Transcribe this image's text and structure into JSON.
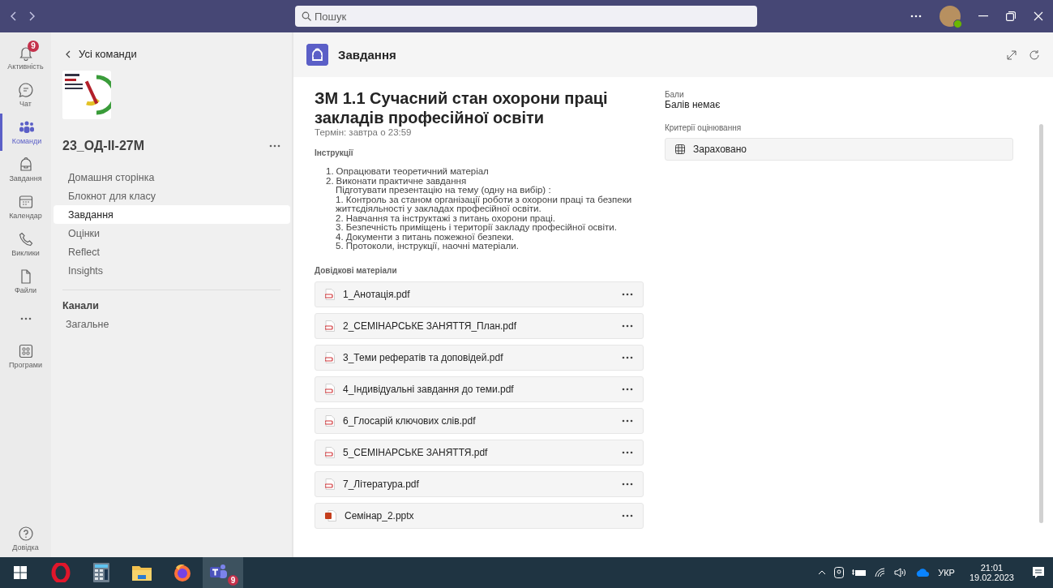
{
  "title_bar": {
    "search": {
      "placeholder": "Пошук"
    }
  },
  "rail": {
    "items": [
      {
        "kind": "bell",
        "label": "Активність",
        "selected": false,
        "badge": "9"
      },
      {
        "kind": "chat",
        "label": "Чат",
        "selected": false
      },
      {
        "kind": "teams",
        "label": "Команди",
        "selected": true
      },
      {
        "kind": "bag",
        "label": "Завдання",
        "selected": false
      },
      {
        "kind": "calendar",
        "label": "Календар",
        "selected": false
      },
      {
        "kind": "phone",
        "label": "Виклики",
        "selected": false
      },
      {
        "kind": "file",
        "label": "Файли",
        "selected": false
      },
      {
        "kind": "more"
      },
      {
        "kind": "apps",
        "label": "Програми",
        "selected": false
      }
    ],
    "help": {
      "label": "Довідка"
    }
  },
  "team_panel": {
    "back": "Усі команди",
    "team_name": "23_ОД-ІІ-27М",
    "nav": [
      {
        "label": "Домашня сторінка",
        "selected": false
      },
      {
        "label": "Блокнот для класу",
        "selected": false
      },
      {
        "label": "Завдання",
        "selected": true
      },
      {
        "label": "Оцінки",
        "selected": false
      },
      {
        "label": "Reflect",
        "selected": false
      },
      {
        "label": "Insights",
        "selected": false
      }
    ],
    "channels_heading": "Канали",
    "channels": [
      "Загальне"
    ]
  },
  "app_header": {
    "title": "Завдання"
  },
  "assignment": {
    "title": "ЗМ 1.1 Сучасний стан охорони праці закладів професійної освіти",
    "due": "Термін: завтра о 23:59",
    "instructions_heading": "Інструкції",
    "instructions": [
      {
        "number": "1.",
        "text": "Опрацювати теоретичний матеріал"
      },
      {
        "number": "2.",
        "text": "Виконати практичне завдання",
        "children": [
          "Підготувати презентацію на тему (одну на вибір) :",
          "1. Контроль за станом організації роботи з охорони праці та безпеки життєдіяльності у закладах професійної освіти.",
          "2. Навчання та інструктажі з питань охорони праці.",
          "3. Безпечність приміщень і території закладу професійної освіти.",
          "4. Документи з питань пожежної безпеки.",
          "5. Протоколи, інструкції, наочні матеріали."
        ]
      }
    ],
    "reference_heading": "Довідкові матеріали",
    "files": [
      {
        "name": "1_Анотація.pdf",
        "kind": "pdf"
      },
      {
        "name": "2_СЕМІНАРСЬКЕ ЗАНЯТТЯ_План.pdf",
        "kind": "pdf"
      },
      {
        "name": "3_Теми рефератів та доповідей.pdf",
        "kind": "pdf"
      },
      {
        "name": "4_Індивідуальні завдання до теми.pdf",
        "kind": "pdf"
      },
      {
        "name": "6_Глосарій ключових слів.pdf",
        "kind": "pdf"
      },
      {
        "name": "5_СЕМІНАРСЬКЕ ЗАНЯТТЯ.pdf",
        "kind": "pdf"
      },
      {
        "name": "7_Література.pdf",
        "kind": "pdf"
      },
      {
        "name": "Семінар_2.pptx",
        "kind": "pptx"
      }
    ],
    "points_label": "Бали",
    "points_value": "Балів немає",
    "rubric_label": "Критерії оцінювання",
    "rubric": "Зараховано"
  },
  "taskbar": {
    "apps": [
      {
        "kind": "opera",
        "selected": false
      },
      {
        "kind": "calculator",
        "selected": false
      },
      {
        "kind": "folder",
        "selected": false
      },
      {
        "kind": "firefox",
        "selected": false
      },
      {
        "kind": "teams",
        "selected": true,
        "badge": "9"
      }
    ],
    "language": "УКР",
    "time": "21:01",
    "date": "19.02.2023"
  }
}
